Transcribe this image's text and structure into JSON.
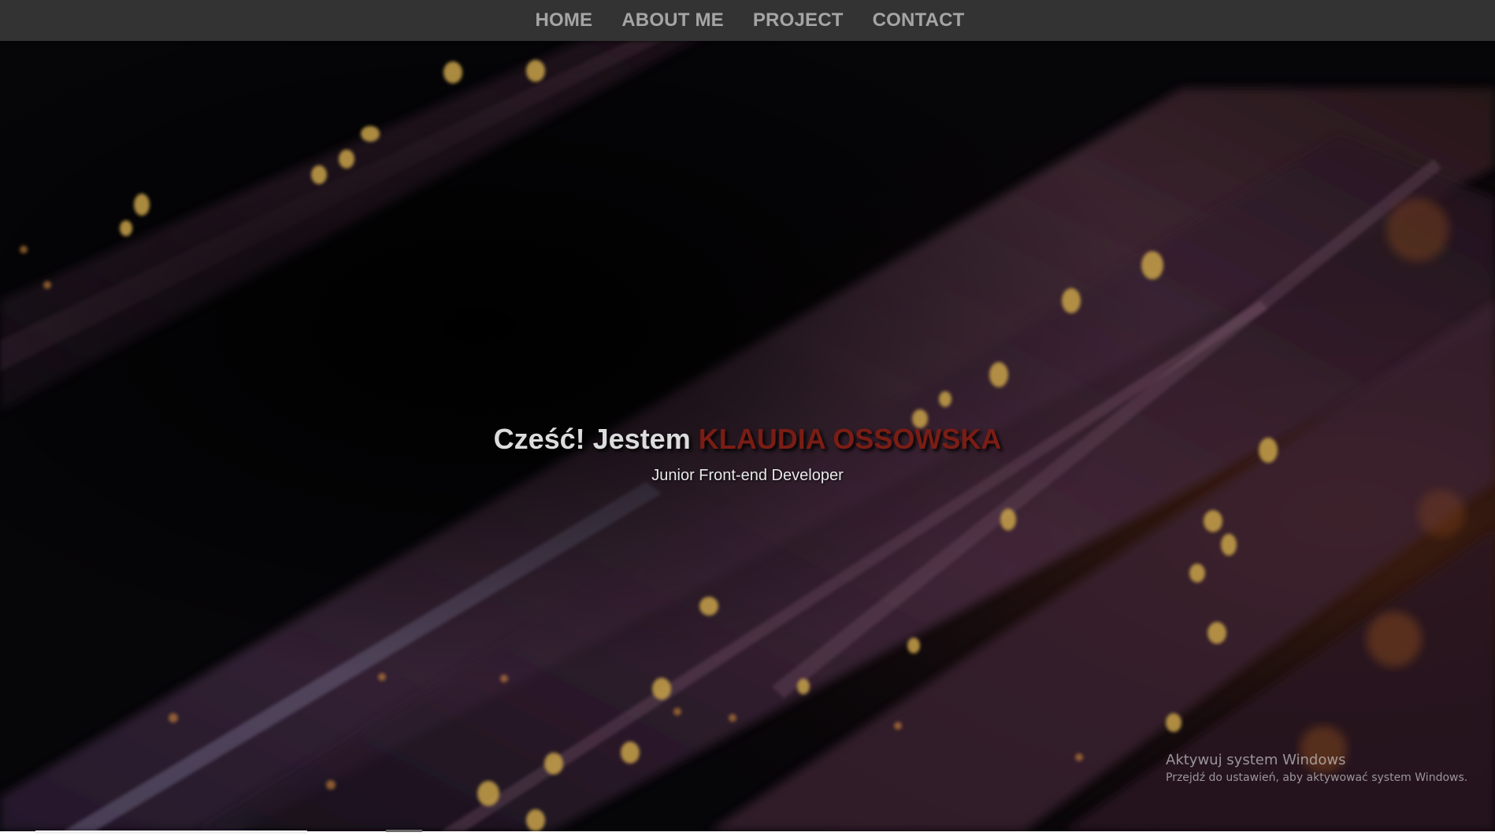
{
  "nav": {
    "items": [
      {
        "label": "HOME"
      },
      {
        "label": "ABOUT ME"
      },
      {
        "label": "PROJECT"
      },
      {
        "label": "CONTACT"
      }
    ]
  },
  "hero": {
    "greeting": "Cześć! Jestem",
    "name": "KLAUDIA OSSOWSKA",
    "subtitle": "Junior Front-end Developer"
  },
  "watermark": {
    "title": "Aktywuj system Windows",
    "text": "Przejdź do ustawień, aby aktywować system Windows."
  },
  "colors": {
    "navbar": "#333333",
    "nav_text": "#a5a5a5",
    "name_accent": "#7a1d14",
    "greeting_text": "#dcdcdc"
  }
}
